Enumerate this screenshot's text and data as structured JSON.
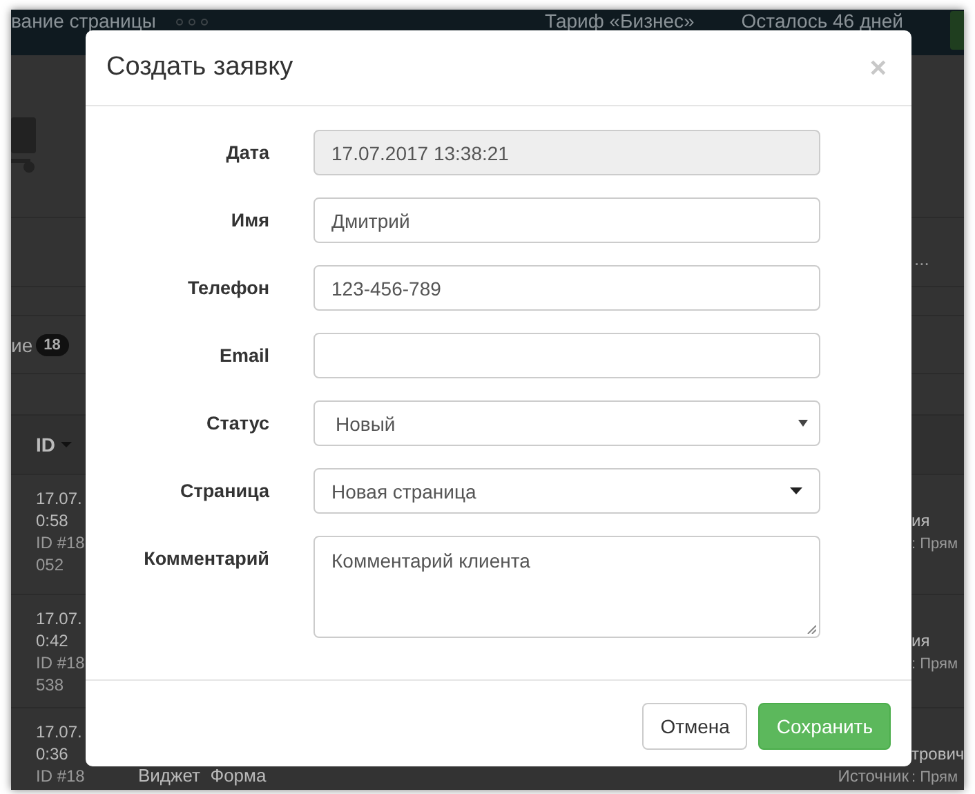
{
  "topbar": {
    "title": "вание страницы",
    "plan": "Тариф «Бизнес»",
    "days_left": "Осталось 46 дней"
  },
  "background": {
    "tab_label": "ие",
    "tab_count": "18",
    "column_header": "ID",
    "more": "...",
    "rows": [
      {
        "lines": [
          "17.07.",
          "0:58",
          "ID #18",
          "052"
        ],
        "right": [
          "ия",
          ": Прям"
        ]
      },
      {
        "lines": [
          "17.07.",
          "0:42",
          "ID #18",
          "538"
        ],
        "right": [
          "ия",
          ": Прям"
        ]
      },
      {
        "lines": [
          "17.07.",
          "0:36",
          "ID #18"
        ],
        "right": [
          "трович",
          ": Прям"
        ],
        "middle": "Виджет  Форма",
        "source": "Источник"
      }
    ]
  },
  "modal": {
    "title": "Создать заявку",
    "close": "×",
    "fields": [
      {
        "label": "Дата",
        "kind": "text",
        "value": "17.07.2017 13:38:21",
        "disabled": true
      },
      {
        "label": "Имя",
        "kind": "text",
        "value": "Дмитрий",
        "disabled": false
      },
      {
        "label": "Телефон",
        "kind": "text",
        "value": "123-456-789",
        "disabled": false
      },
      {
        "label": "Email",
        "kind": "text",
        "disabled": false
      },
      {
        "label": "Статус",
        "kind": "select",
        "value": "Новый",
        "disabled": false
      },
      {
        "label": "Страница",
        "kind": "dropdown",
        "value": "Новая страница",
        "disabled": false
      },
      {
        "label": "Комментарий",
        "kind": "textarea",
        "value": "Комментарий клиента",
        "disabled": false
      }
    ],
    "buttons": [
      {
        "label": "Отмена",
        "kind": "default"
      },
      {
        "label": "Сохранить",
        "kind": "primary"
      }
    ]
  }
}
